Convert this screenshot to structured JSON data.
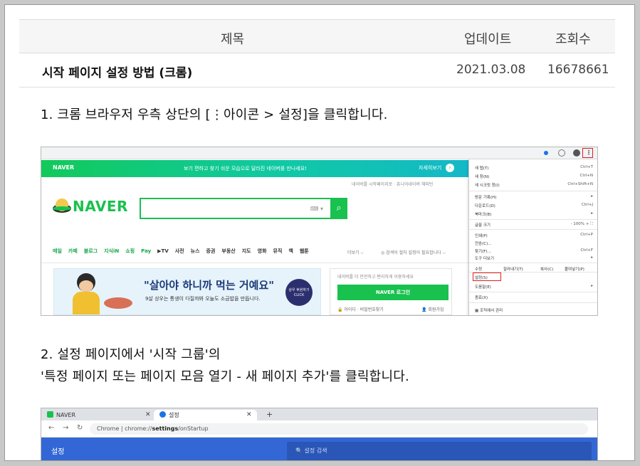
{
  "table": {
    "headers": {
      "title": "제목",
      "updated": "업데이트",
      "views": "조회수"
    },
    "row": {
      "title": "시작 페이지 설정 방법 (크롬)",
      "date": "2021.03.08",
      "views": "16678661"
    }
  },
  "steps": {
    "step1": "1. 크롬 브라우저 우측 상단의 [⋮아이콘 > 설정]을 클릭합니다.",
    "step2_line1": "2. 설정 페이지에서 '시작 그룹'의",
    "step2_line2": "'특정 페이지 또는 페이지 모음 열기 - 새 페이지 추가'를 클릭합니다."
  },
  "shot1": {
    "banner_brand": "NAVER",
    "banner_message": "보기 편하고 찾기 쉬운 모습으로 달라진 네이버를 만나세요!",
    "banner_button": "자세히보기",
    "sublinks": "네이버를 시작페이지로 ·  쥬니어네이버   해피빈",
    "logo_text": "NAVER",
    "search_kbd": "⌨ ▾",
    "nav_items": [
      "메일",
      "카페",
      "블로그",
      "지식iN",
      "쇼핑",
      "Pay",
      "▶TV",
      "사전",
      "뉴스",
      "증권",
      "부동산",
      "지도",
      "영화",
      "뮤직",
      "책",
      "웹툰"
    ],
    "nav_more": "더보기 ⌵",
    "nav_hint": "◎ 검색어 절차 설정이 필요합니다 ⌵",
    "ad_title": "\"살아야 하니까 먹는 거예요\"",
    "ad_sub": "9살 상우는 통생이 다질까봐 오늘도 소금밥을 만듭니다.",
    "ad_badge": "상우 후원하기 CLICK",
    "login_msg": "네이버를 더 안전하고 편리하게 이용하세요",
    "login_btn": "NAVER 로그인",
    "login_links": "🔒 아이디 · 비밀번호찾기",
    "login_join": "👤 회원가입",
    "menu": {
      "new_tab": "새 탭(T)",
      "new_tab_key": "Ctrl+T",
      "new_window": "새 창(N)",
      "new_window_key": "Ctrl+N",
      "incognito": "새 시크릿 창(I)",
      "incognito_key": "Ctrl+Shift+N",
      "history": "방문 기록(H)",
      "downloads": "다운로드(D)",
      "downloads_key": "Ctrl+J",
      "bookmarks": "북마크(B)",
      "zoom": "글꼴 크기",
      "zoom_val": "-   100%   +   ⛶",
      "print": "인쇄(P)",
      "print_key": "Ctrl+P",
      "cast": "전송(C)...",
      "find": "찾기(F)...",
      "find_key": "Ctrl+F",
      "more_tools": "도구 더보기",
      "edit": "수정",
      "cut": "잘라내기(T)",
      "copy": "복사(C)",
      "paste": "붙여넣기(P)",
      "settings": "설정(S)",
      "help": "도움말(E)",
      "exit": "종료(X)",
      "managed": "조직에서 관리"
    }
  },
  "shot2": {
    "tab1": "NAVER",
    "tab2": "설정",
    "omni_prefix": "Chrome | chrome://",
    "omni_bold": "settings",
    "omni_suffix": "/onStartup",
    "title": "설정",
    "search": "🔍  설정 검색"
  }
}
